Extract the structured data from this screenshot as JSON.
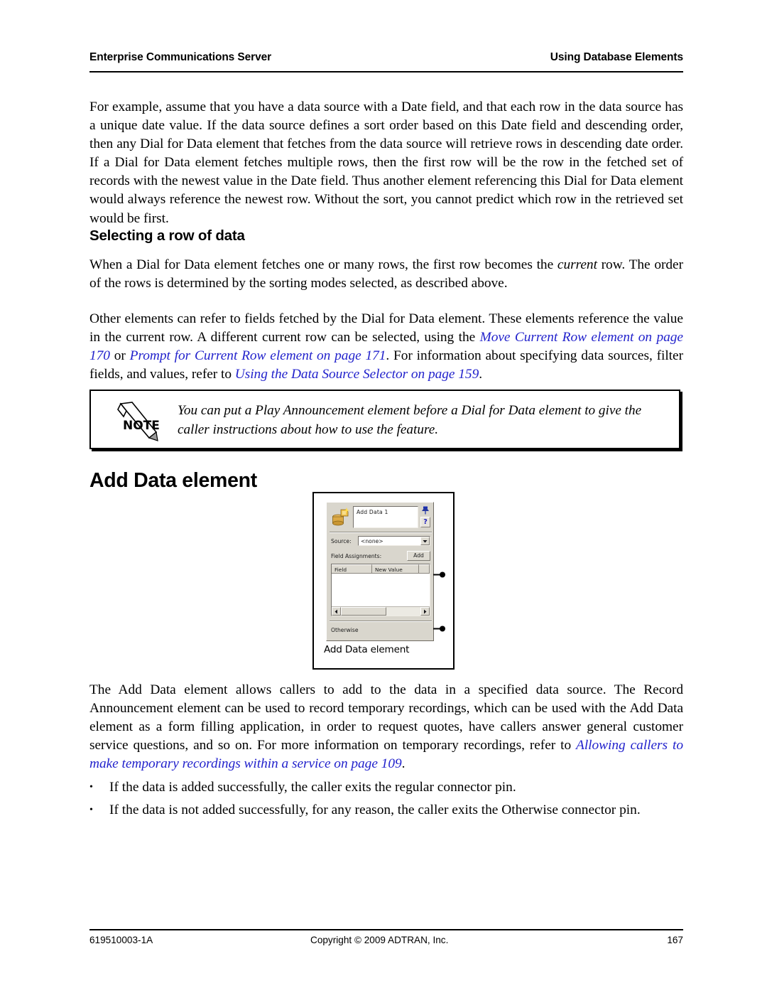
{
  "header": {
    "left": "Enterprise Communications Server",
    "right": "Using Database Elements"
  },
  "intro_paragraph": "For example, assume that you have a data source with a Date field, and that each row in the data source has a unique date value. If the data source defines a sort order based on this Date field and descending order, then any Dial for Data element that fetches from the data source will retrieve rows in descending date order. If a Dial for Data element fetches multiple rows, then the first row will be the row in the fetched set of records with the newest value in the Date field. Thus another element referencing this Dial for Data element would always reference the newest row. Without the sort, you cannot predict which row in the retrieved set would be first.",
  "section_selecting": {
    "heading": "Selecting a row of data",
    "para1_before_em": "When a Dial for Data element fetches one or many rows, the first row becomes the ",
    "para1_em": "current",
    "para1_after_em": " row. The order of the rows is determined by the sorting modes selected, as described above.",
    "para2_part1": "Other elements can refer to fields fetched by the Dial for Data element. These elements reference the value in the current row. A different current row can be selected, using the ",
    "para2_link1": "Move Current Row element on page 170",
    "para2_part2": " or ",
    "para2_link2": "Prompt for Current Row element on page 171",
    "para2_part3": ". For information about specifying data sources, filter fields, and values, refer to ",
    "para2_link3": "Using the Data Source Selector on page 159",
    "para2_part4": "."
  },
  "note": {
    "icon_label": "NOTE",
    "text": "You can put a Play Announcement element before a Dial for Data element to give the caller instructions about how to use the feature."
  },
  "section_add_data": {
    "heading": "Add Data element",
    "figure": {
      "caption": "Add Data element",
      "dialog": {
        "element_name": "Add Data 1",
        "help_label": "?",
        "source_label": "Source:",
        "source_value": "<none>",
        "field_assignments_label": "Field Assignments:",
        "add_button": "Add",
        "columns": [
          "Field",
          "New Value"
        ],
        "otherwise_label": "Otherwise"
      }
    },
    "para_part1": "The Add Data element allows callers to add to the data in a specified data source. The Record Announcement element can be used to record temporary recordings, which can be used with the Add Data element as a form filling application, in order to request quotes, have callers answer general customer service questions, and so on. For more information on temporary recordings, refer to ",
    "para_link": "Allowing callers to make temporary recordings within a service on page 109",
    "para_part2": ".",
    "bullets": [
      "If the data is added successfully, the caller exits the regular connector pin.",
      "If the data is not added successfully, for any reason, the caller exits the Otherwise connector pin."
    ]
  },
  "footer": {
    "doc_number": "619510003-1A",
    "copyright": "Copyright © 2009 ADTRAN, Inc.",
    "page_number": "167"
  },
  "colors": {
    "link": "#2222cc",
    "dialog_face": "#d9d6cd",
    "help_blue": "#1b1bbb"
  }
}
